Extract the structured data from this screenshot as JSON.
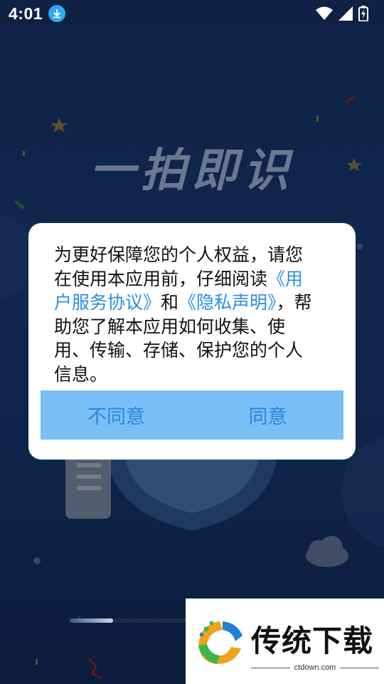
{
  "status_bar": {
    "time": "4:01",
    "icons": [
      "download-badge-icon",
      "wifi-icon",
      "signal-icon",
      "battery-charging-icon"
    ]
  },
  "hero": {
    "title": "一拍即识"
  },
  "dialog": {
    "text_intro": "为更好保障您的个人权益，请您在使用本应用前，仔细阅读",
    "link_user_agreement": "《用户服务协议》",
    "text_and": "和",
    "link_privacy": "《隐私声明》",
    "text_rest": "，帮助您了解本应用如何收集、使用、传输、存储、保护您的个人信息。",
    "disagree_label": "不同意",
    "agree_label": "同意"
  },
  "progress": {
    "value": 0.36
  },
  "watermark": {
    "title": "传统下载",
    "url": "ctdown.com",
    "logo_icon": "ctdown-logo-icon"
  },
  "colors": {
    "accent": "#2a8de6",
    "button_bg": "#79bff7",
    "button_text": "#2b86dc",
    "background": "#1b3f7c"
  }
}
